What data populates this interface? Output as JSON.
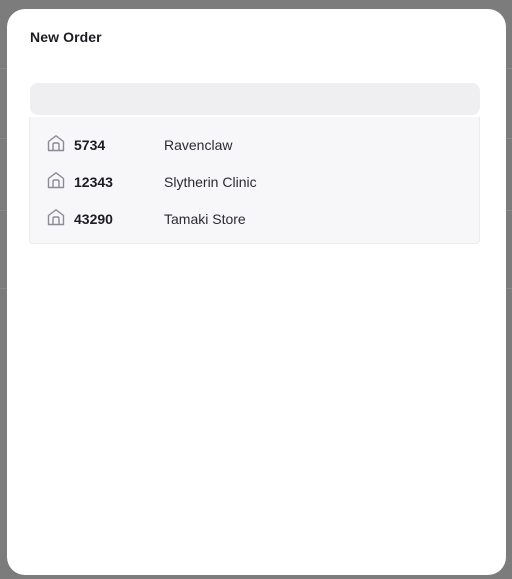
{
  "modal": {
    "title": "New Order",
    "search": {
      "value": "",
      "placeholder": ""
    },
    "results": [
      {
        "icon": "store-icon",
        "code": "5734",
        "name": "Ravenclaw"
      },
      {
        "icon": "store-icon",
        "code": "12343",
        "name": "Slytherin Clinic"
      },
      {
        "icon": "store-icon",
        "code": "43290",
        "name": "Tamaki Store"
      }
    ]
  },
  "colors": {
    "overlay": "#7c7c7c",
    "modal_bg": "#ffffff",
    "input_bg": "#efeff1",
    "dropdown_bg": "#f7f7f9",
    "icon_stroke": "#8b8b98"
  }
}
